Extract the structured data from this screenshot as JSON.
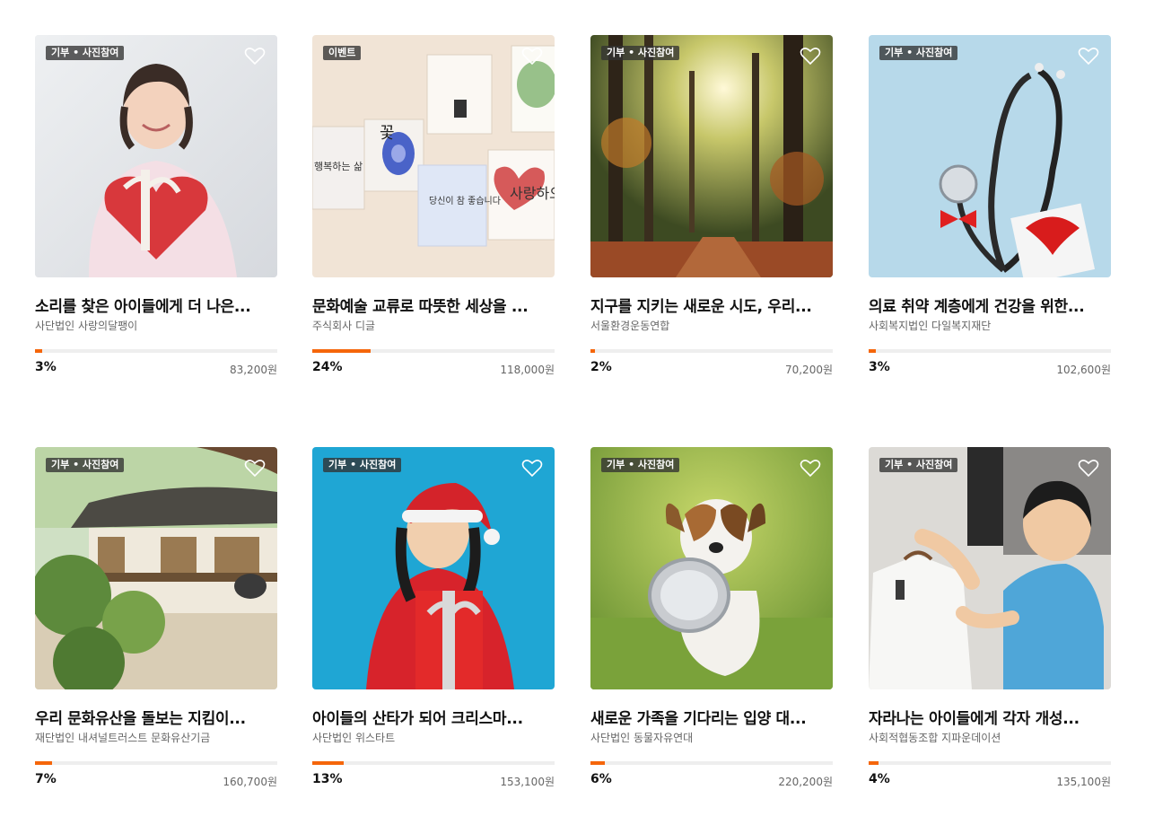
{
  "cards": [
    {
      "tag": "기부 • 사진참여",
      "title": "소리를 찾은 아이들에게 더 나은...",
      "org": "사단법인 사랑의달팽이",
      "progress_pct": 3,
      "percent": "3%",
      "amount": "83,200원",
      "image": "girl-holding-heart-box"
    },
    {
      "tag": "이벤트",
      "title": "문화예술 교류로 따뜻한 세상을 ...",
      "org": "주식회사 디글",
      "progress_pct": 24,
      "percent": "24%",
      "amount": "118,000원",
      "image": "calligraphy-canvases",
      "image_text": [
        "사랑하오",
        "당신이 참 좋습니다",
        "행복하는 삶",
        "꽃"
      ]
    },
    {
      "tag": "기부 • 사진참여",
      "title": "지구를 지키는 새로운 시도, 우리...",
      "org": "서울환경운동연합",
      "progress_pct": 2,
      "percent": "2%",
      "amount": "70,200원",
      "image": "autumn-forest-path"
    },
    {
      "tag": "기부 • 사진참여",
      "title": "의료 취약 계층에게 건강을 위한...",
      "org": "사회복지법인 다일복지재단",
      "progress_pct": 3,
      "percent": "3%",
      "amount": "102,600원",
      "image": "stethoscope-gift"
    },
    {
      "tag": "기부 • 사진참여",
      "title": "우리 문화유산을 돌보는 지킴이...",
      "org": "재단법인 내셔널트러스트 문화유산기금",
      "progress_pct": 7,
      "percent": "7%",
      "amount": "160,700원",
      "image": "hanok-house"
    },
    {
      "tag": "기부 • 사진참여",
      "title": "아이들의 산타가 되어 크리스마...",
      "org": "사단법인 위스타트",
      "progress_pct": 13,
      "percent": "13%",
      "amount": "153,100원",
      "image": "girl-santa-gift"
    },
    {
      "tag": "기부 • 사진참여",
      "title": "새로운 가족을 기다리는 입양 대...",
      "org": "사단법인 동물자유연대",
      "progress_pct": 6,
      "percent": "6%",
      "amount": "220,200원",
      "image": "dog-with-bowl"
    },
    {
      "tag": "기부 • 사진참여",
      "title": "자라나는 아이들에게 각자 개성...",
      "org": "사회적협동조합 지파운데이션",
      "progress_pct": 4,
      "percent": "4%",
      "amount": "135,100원",
      "image": "boy-choosing-clothes"
    }
  ],
  "colors": {
    "accent": "#f5660a",
    "track": "#eeeeee"
  }
}
